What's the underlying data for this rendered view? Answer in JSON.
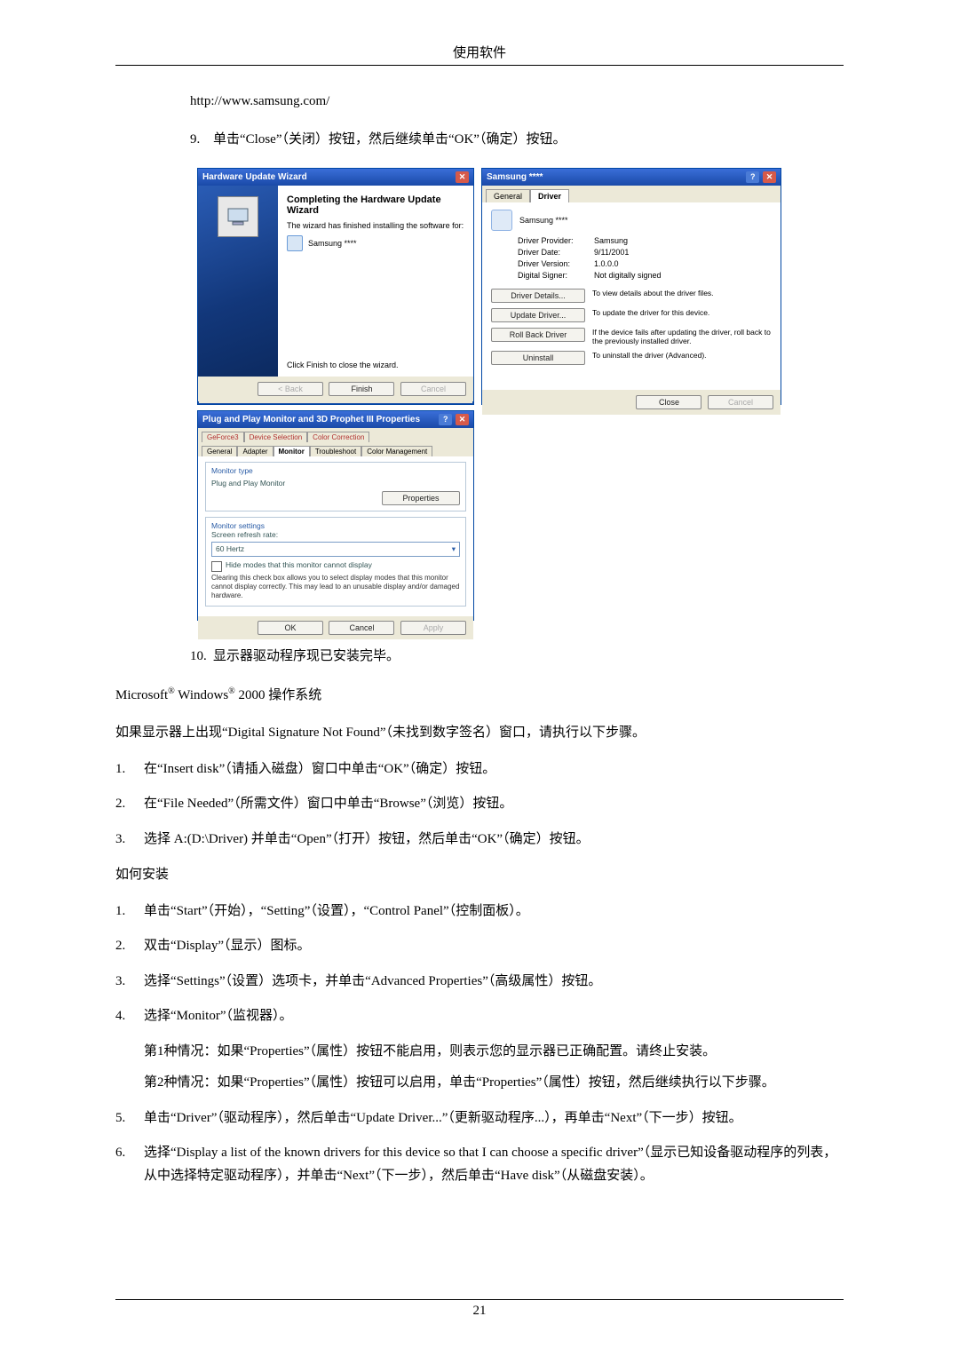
{
  "header": {
    "title": "使用软件"
  },
  "url": "http://www.samsung.com/",
  "step9": {
    "num": "9.",
    "text": "单击“Close”（关闭）按钮，然后继续单击“OK”（确定）按钮。"
  },
  "wizard_left": {
    "title": "Hardware Update Wizard",
    "heading": "Completing the Hardware Update Wizard",
    "sub": "The wizard has finished installing the software for:",
    "device": "Samsung ****",
    "hint": "Click Finish to close the wizard.",
    "btn_back": "< Back",
    "btn_finish": "Finish",
    "btn_cancel": "Cancel"
  },
  "wizard_right": {
    "title": "Samsung ****",
    "tab_general": "General",
    "tab_driver": "Driver",
    "device_name": "Samsung ****",
    "rows": [
      {
        "k": "Driver Provider:",
        "v": "Samsung"
      },
      {
        "k": "Driver Date:",
        "v": "9/11/2001"
      },
      {
        "k": "Driver Version:",
        "v": "1.0.0.0"
      },
      {
        "k": "Digital Signer:",
        "v": "Not digitally signed"
      }
    ],
    "actions": [
      {
        "btn": "Driver Details...",
        "desc": "To view details about the driver files."
      },
      {
        "btn": "Update Driver...",
        "desc": "To update the driver for this device."
      },
      {
        "btn": "Roll Back Driver",
        "desc": "If the device fails after updating the driver, roll back to the previously installed driver."
      },
      {
        "btn": "Uninstall",
        "desc": "To uninstall the driver (Advanced)."
      }
    ],
    "btn_close": "Close",
    "btn_cancel": "Cancel"
  },
  "wizard_bottom": {
    "title": "Plug and Play Monitor and 3D Prophet III Properties",
    "tabs_row1": [
      "GeForce3",
      "Device Selection",
      "Color Correction"
    ],
    "tabs_row2": [
      "General",
      "Adapter",
      "Monitor",
      "Troubleshoot",
      "Color Management"
    ],
    "grp1_label": "Monitor type",
    "grp1_name": "Plug and Play Monitor",
    "grp1_btn": "Properties",
    "grp2_label": "Monitor settings",
    "grp2_rate_label": "Screen refresh rate:",
    "grp2_rate_value": "60 Hertz",
    "cb_text": "Hide modes that this monitor cannot display",
    "note": "Clearing this check box allows you to select display modes that this monitor cannot display correctly. This may lead to an unusable display and/or damaged hardware.",
    "btn_ok": "OK",
    "btn_cancel": "Cancel",
    "btn_apply": "Apply"
  },
  "step10": {
    "num": "10.",
    "text": "显示器驱动程序现已安装完毕。"
  },
  "os_line": {
    "prefix": "Microsoft",
    "mid": " Windows",
    "suffix": " 2000 操作系统"
  },
  "sig_para": "如果显示器上出现“Digital Signature Not Found”（未找到数字签名）窗口，请执行以下步骤。",
  "list1": [
    {
      "n": "1.",
      "t": "在“Insert disk”（请插入磁盘）窗口中单击“OK”（确定）按钮。"
    },
    {
      "n": "2.",
      "t": "在“File Needed”（所需文件）窗口中单击“Browse”（浏览）按钮。"
    },
    {
      "n": "3.",
      "t": "选择 A:(D:\\Driver) 并单击“Open”（打开）按钮，然后单击“OK”（确定）按钮。"
    }
  ],
  "how_install": "如何安装",
  "list2": [
    {
      "n": "1.",
      "t": "单击“Start”（开始），“Setting”（设置），“Control Panel”（控制面板）。"
    },
    {
      "n": "2.",
      "t": "双击“Display”（显示）图标。"
    },
    {
      "n": "3.",
      "t": "选择“Settings”（设置）选项卡，并单击“Advanced Properties”（高级属性）按钮。"
    },
    {
      "n": "4.",
      "t": "选择“Monitor”（监视器）。",
      "sub": [
        "第1种情况：如果“Properties”（属性）按钮不能启用，则表示您的显示器已正确配置。请终止安装。",
        "第2种情况：如果“Properties”（属性）按钮可以启用，单击“Properties”（属性）按钮，然后继续执行以下步骤。"
      ]
    },
    {
      "n": "5.",
      "t": "单击“Driver”（驱动程序），然后单击“Update  Driver...”（更新驱动程序...），再单击“Next”（下一步）按钮。"
    },
    {
      "n": "6.",
      "t": "选择“Display a list of the known drivers for this device so that I can choose a specific driver”（显示已知设备驱动程序的列表，从中选择特定驱动程序），并单击“Next”（下一步），然后单击“Have disk”（从磁盘安装）。"
    }
  ],
  "page_number": "21"
}
